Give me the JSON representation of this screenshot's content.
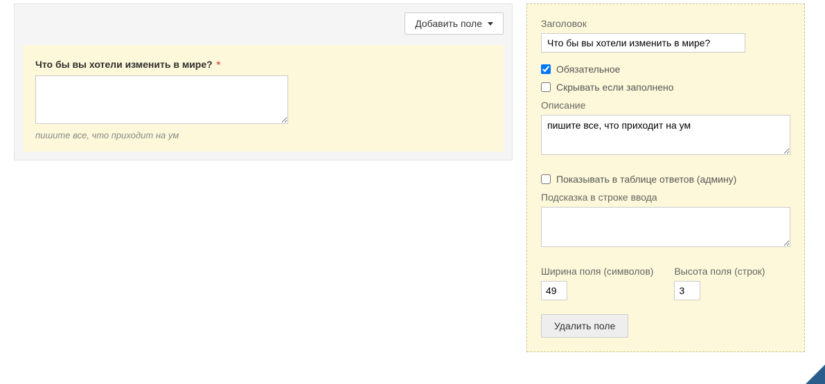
{
  "leftPanel": {
    "addFieldLabel": "Добавить поле",
    "preview": {
      "label": "Что бы вы хотели изменить в мире?",
      "required": "*",
      "value": "",
      "hint": "пишите все, что приходит на ум"
    }
  },
  "rightPanel": {
    "titleLabel": "Заголовок",
    "titleValue": "Что бы вы хотели изменить в мире?",
    "requiredLabel": "Обязательное",
    "requiredChecked": true,
    "hideIfFilledLabel": "Скрывать если заполнено",
    "hideIfFilledChecked": false,
    "descriptionLabel": "Описание",
    "descriptionValue": "пишите все, что приходит на ум",
    "showInTableLabel": "Показывать в таблице ответов (админу)",
    "showInTableChecked": false,
    "placeholderLabel": "Подсказка в строке ввода",
    "placeholderValue": "",
    "widthLabel": "Ширина поля (символов)",
    "widthValue": "49",
    "heightLabel": "Высота поля (строк)",
    "heightValue": "3",
    "deleteLabel": "Удалить поле"
  }
}
